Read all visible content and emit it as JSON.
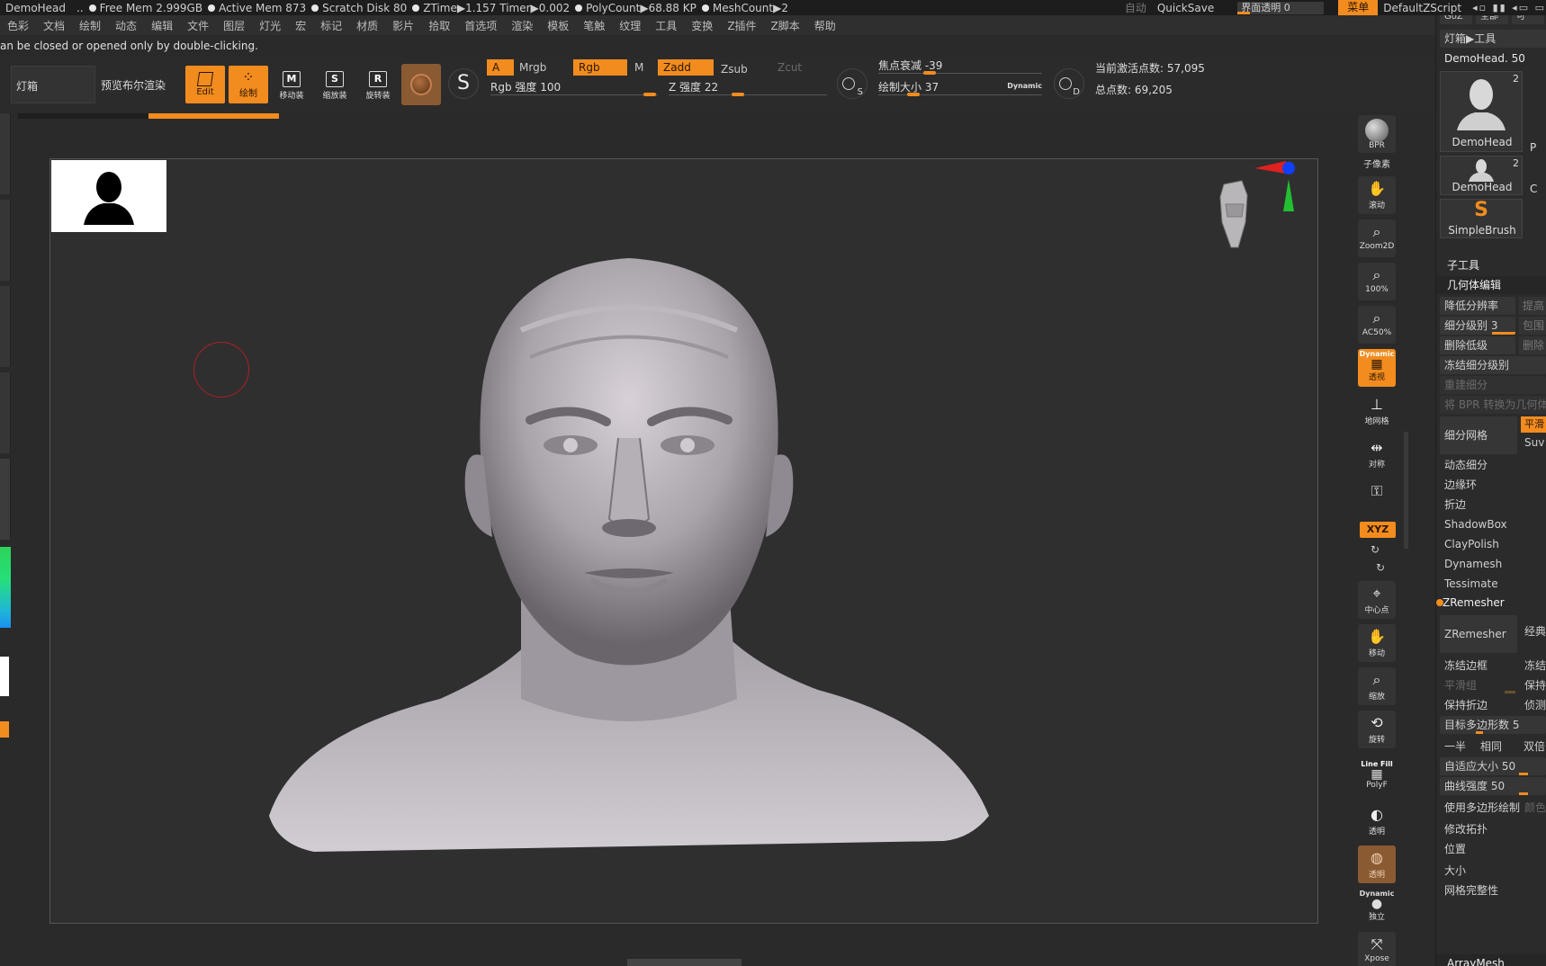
{
  "status": {
    "project": "DemoHead",
    "ellipsis": "..",
    "free_mem": "Free Mem 2.999GB",
    "active_mem": "Active Mem 873",
    "scratch": "Scratch Disk 80",
    "ztime": "ZTime▶1.157 Timer▶0.002",
    "polycount": "PolyCount▶68.88 KP",
    "meshcount": "MeshCount▶2",
    "auto": "自动",
    "quicksave": "QuickSave",
    "ui_opacity": "界面透明 0",
    "menus_btn": "菜单",
    "default_script": "DefaultZScript"
  },
  "menu": [
    "色彩",
    "文档",
    "绘制",
    "动态",
    "编辑",
    "文件",
    "图层",
    "灯光",
    "宏",
    "标记",
    "材质",
    "影片",
    "拾取",
    "首选项",
    "渲染",
    "模板",
    "笔触",
    "纹理",
    "工具",
    "变换",
    "Z插件",
    "Z脚本",
    "帮助"
  ],
  "message": "an be closed or opened only by double-clicking.",
  "shelf": {
    "lightbox": "灯箱",
    "bpr_preview": "预览布尔渲染",
    "edit": "Edit",
    "draw": "绘制",
    "move": "移动装",
    "scale": "缩放装",
    "rotate": "旋转装",
    "a_label": "A",
    "mrgb": "Mrgb",
    "rgb": "Rgb",
    "m": "M",
    "zadd": "Zadd",
    "zsub": "Zsub",
    "zcut": "Zcut",
    "rgb_intensity": "Rgb 强度 100",
    "z_intensity": "Z 强度 22",
    "focal_shift": "焦点衰减 -39",
    "draw_size": "绘制大小 37",
    "dynamic": "Dynamic",
    "active_points": "当前激活点数: 57,095",
    "total_points": "总点数: 69,205",
    "s_letter": "S",
    "d_letter": "D"
  },
  "right_tools": {
    "bpr": "BPR",
    "subpixel": "子像素",
    "scroll": "滚动",
    "zoom2d": "Zoom2D",
    "p100": "100%",
    "ac50": "AC50%",
    "dynamic_persp": "Dynamic",
    "persp": "透视",
    "floor": "地网格",
    "sym": "对称",
    "xyz": "XYZ",
    "center": "中心点",
    "move": "移动",
    "scale": "缩放",
    "rotate": "旋转",
    "linefill": "Line Fill",
    "polyf": "PolyF",
    "transp": "透明",
    "ghost": "透明",
    "dynamic2": "Dynamic",
    "solo": "独立",
    "xpose": "Xpose"
  },
  "palette": {
    "top_buttons": [
      "GoZ",
      "全部",
      "可"
    ],
    "header": "灯箱▶工具",
    "current_tool": "DemoHead. 50",
    "tool1": "DemoHead",
    "tool1_badge": "2",
    "tool1_side": "P",
    "tool2": "DemoHead",
    "tool2_badge": "2",
    "tool2_side": "C",
    "tool3": "SimpleBrush",
    "subtool": "子工具",
    "geometry": "几何体编辑",
    "lower_res": "降低分辨率",
    "higher_res": "提高",
    "sdiv": "细分级别 3",
    "cage": "包围",
    "del_lower": "删除低级",
    "del_higher": "删除",
    "freeze_sdiv": "冻结细分级别",
    "reconstruct": "重建细分",
    "bpr_to_geo": "将 BPR 转换为几何体",
    "divide": "细分网格",
    "smooth": "平滑",
    "suv": "Suv",
    "dynamic_sub": "动态细分",
    "edge_loop": "边缘环",
    "crease": "折边",
    "shadowbox": "ShadowBox",
    "claypolish": "ClayPolish",
    "dynamesh": "Dynamesh",
    "tessimate": "Tessimate",
    "zremesher_head": "ZRemesher",
    "zremesher_btn": "ZRemesher",
    "legacy": "经典",
    "freeze_border": "冻结边框",
    "freeze_groups": "冻结",
    "smooth_groups": "平滑组",
    "keep_groups": "保持",
    "keep_creases": "保持折边",
    "detect_edges": "侦测",
    "target_poly": "目标多边形数 5",
    "half": "一半",
    "same": "相同",
    "double": "双倍",
    "adaptive": "自适应大小 50",
    "curve_strength": "曲线强度 50",
    "use_polypaint": "使用多边形绘制",
    "color": "颜色",
    "modify_topo": "修改拓扑",
    "position": "位置",
    "size": "大小",
    "mesh_integrity": "网格完整性",
    "arraymesh": "ArrayMesh"
  },
  "colors": {
    "accent": "#f28c1f",
    "bg": "#2a2a2a",
    "viewport": "#2f2f30"
  }
}
